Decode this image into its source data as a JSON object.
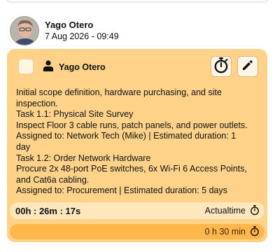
{
  "post": {
    "author_name": "Yago Otero",
    "timestamp": "7 Aug 2026 - 09:49"
  },
  "task": {
    "assignee": "Yago Otero",
    "description_lines": [
      "Initial scope definition, hardware purchasing, and site",
      "inspection.",
      "Task 1.1: Physical Site Survey",
      "Inspect Floor 3 cable runs, patch panels, and power outlets.",
      "Assigned to: Network Tech (Mike) | Estimated duration: 1",
      "day",
      "Task 1.2: Order Network Hardware",
      "Procure 2x 48-port PoE switches, 6x Wi-Fi 6 Access Points,",
      "and Cat6a cabling.",
      "Assigned to: Procurement | Estimated duration: 5 days"
    ],
    "actual_time": "00h : 26m : 17s",
    "actual_label": "Actualtime",
    "estimate": "0 h 30 min"
  },
  "icons": {
    "timer_button": "stopwatch-icon",
    "edit_button": "pencil-icon",
    "assignee": "person-icon",
    "actual": "stopwatch-icon",
    "estimate": "stopwatch-icon"
  },
  "colors": {
    "card": "#ffd28a",
    "actual_bar": "#ffe6bd",
    "estimate_bar": "#ffb64a"
  }
}
